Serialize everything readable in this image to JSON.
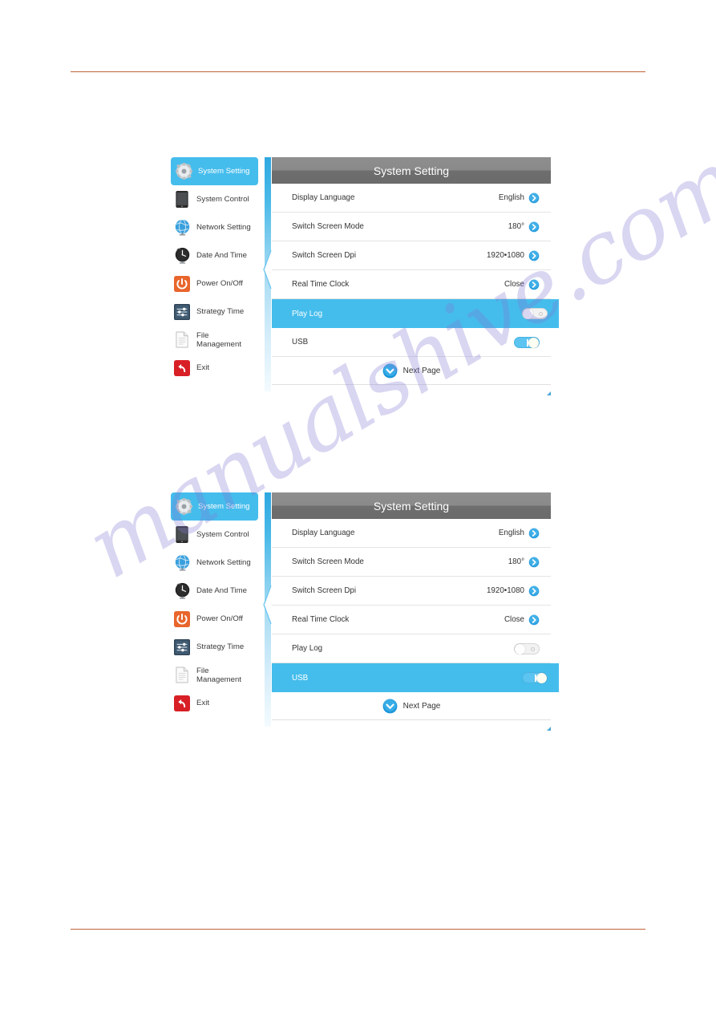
{
  "page": {
    "rule_color": "#c0623a",
    "watermark_text": "manualshive.com"
  },
  "accent": {
    "highlight_blue": "#45bdec",
    "toggle_on_blue": "#5bc4f1",
    "header_gray": "#7a7a7a"
  },
  "sidebar": {
    "items": [
      {
        "label": "System Setting",
        "icon": "gear-icon",
        "active": true
      },
      {
        "label": "System Control",
        "icon": "tablet-icon",
        "active": false
      },
      {
        "label": "Network Setting",
        "icon": "globe-icon",
        "active": false
      },
      {
        "label": "Date And Time",
        "icon": "clock-icon",
        "active": false
      },
      {
        "label": "Power On/Off",
        "icon": "power-icon",
        "active": false
      },
      {
        "label": "Strategy Time",
        "icon": "sliders-icon",
        "active": false
      },
      {
        "label": "File\nManagement",
        "icon": "document-icon",
        "active": false
      },
      {
        "label": "Exit",
        "icon": "exit-arrow-icon",
        "active": false
      }
    ]
  },
  "panel": {
    "title": "System Setting",
    "rows": [
      {
        "label": "Display Language",
        "value": "English",
        "control": "chevron",
        "selected_fig1": false,
        "selected_fig2": false
      },
      {
        "label": "Switch Screen Mode",
        "value": "180°",
        "control": "chevron",
        "selected_fig1": false,
        "selected_fig2": false
      },
      {
        "label": "Switch Screen Dpi",
        "value": "1920•1080",
        "control": "chevron",
        "selected_fig1": false,
        "selected_fig2": false
      },
      {
        "label": "Real Time Clock",
        "value": "Close",
        "control": "chevron",
        "selected_fig1": false,
        "selected_fig2": false
      },
      {
        "label": "Play Log",
        "value": "",
        "control": "toggle-off",
        "selected_fig1": true,
        "selected_fig2": false
      },
      {
        "label": "USB",
        "value": "",
        "control": "toggle-on",
        "selected_fig1": false,
        "selected_fig2": true
      }
    ],
    "footer": {
      "next_page_label": "Next Page",
      "next_page_icon": "chevron-down-circle-icon"
    }
  }
}
